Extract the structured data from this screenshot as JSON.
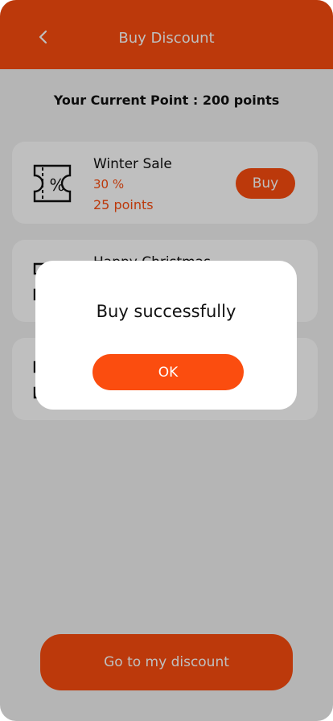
{
  "colors": {
    "accent": "#fb4d0f",
    "background": "#f2f2f2",
    "card": "#ffffff",
    "text": "#111111",
    "overlay": "rgba(0,0,0,0.25)"
  },
  "header": {
    "title": "Buy Discount",
    "back_icon": "chevron-left-icon"
  },
  "points_label": "Your Current Point : 200 points",
  "coupons": [
    {
      "name": "Winter Sale",
      "discount": "30 %",
      "cost": "25 points",
      "buy_label": "Buy",
      "icon": "discount-ticket-icon"
    },
    {
      "name": "Happy Christmas",
      "icon": "discount-ticket-icon"
    },
    {
      "icon": "discount-ticket-icon"
    }
  ],
  "bottom_button": {
    "label": "Go to my discount"
  },
  "dialog": {
    "message": "Buy successfully",
    "ok_label": "OK"
  }
}
